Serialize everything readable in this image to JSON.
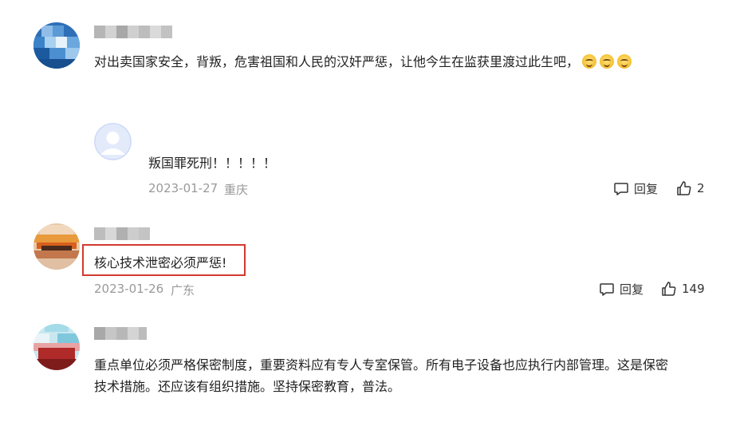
{
  "comments": [
    {
      "text": "对出卖国家安全，背叛，危害祖国和人民的汉奸严惩，让他今生在监获里渡过此生吧，",
      "emoji_icons": [
        "grin-emoji-icon",
        "grin-emoji-icon",
        "grin-emoji-icon"
      ],
      "reply": {
        "text": "叛国罪死刑！！！！！",
        "date": "2023-01-27",
        "location": "重庆",
        "reply_label": "回复",
        "like_count": "2"
      }
    },
    {
      "text": "核心技术泄密必须严惩!",
      "date": "2023-01-26",
      "location": "广东",
      "reply_label": "回复",
      "like_count": "149"
    },
    {
      "text_line1": "重点单位必须严格保密制度，重要资料应有专人专室保管。所有电子设备也应执行内部管理。这是保密",
      "text_line2": "技术措施。还应该有组织措施。坚持保密教育，普法。"
    }
  ],
  "colors": {
    "highlight_border": "#d13a2e",
    "meta_text": "#999999",
    "body_text": "#222222"
  }
}
